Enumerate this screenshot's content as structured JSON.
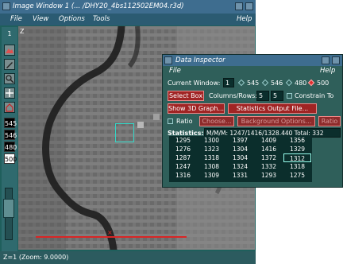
{
  "image_window": {
    "title": "Image Window 1 (... /DHY20_4bs112502EM04.r3d)",
    "menu": [
      "File",
      "View",
      "Options",
      "Tools"
    ],
    "help": "Help",
    "toolbar_top_label": "1",
    "z_label": "Z",
    "wavelengths": [
      "545",
      "546",
      "480",
      "500"
    ],
    "status": "Z=1 (Zoom: 9.0000)",
    "scale_label": "×"
  },
  "data_inspector": {
    "title": "Data Inspector",
    "menu_file": "File",
    "menu_help": "Help",
    "current_window_label": "Current Window:",
    "current_window_value": "1",
    "wavelength_options": [
      "545",
      "546",
      "480",
      "500"
    ],
    "selected_wavelength": "500",
    "select_box_label": "Select Box",
    "columns_rows_label": "Columns/Rows:",
    "columns_value": "5",
    "rows_value": "5",
    "constrain_label": "Constrain To",
    "show_3d_graph_label": "Show 3D Graph...",
    "statistics_output_label": "Statistics Output File...",
    "ratio_label": "Ratio",
    "choose_label": "Choose...",
    "background_options_label": "Background Options...",
    "ratio_button_label": "Ratio",
    "statistics_label": "Statistics:",
    "statistics_value": "M/M/M: 1247/1416/1328.440 Total: 332",
    "grid": [
      [
        "1295",
        "1300",
        "1397",
        "1409",
        "1356"
      ],
      [
        "1276",
        "1323",
        "1304",
        "1416",
        "1329"
      ],
      [
        "1287",
        "1318",
        "1304",
        "1372",
        "1312"
      ],
      [
        "1247",
        "1308",
        "1324",
        "1332",
        "1318"
      ],
      [
        "1316",
        "1309",
        "1331",
        "1293",
        "1275"
      ]
    ]
  }
}
